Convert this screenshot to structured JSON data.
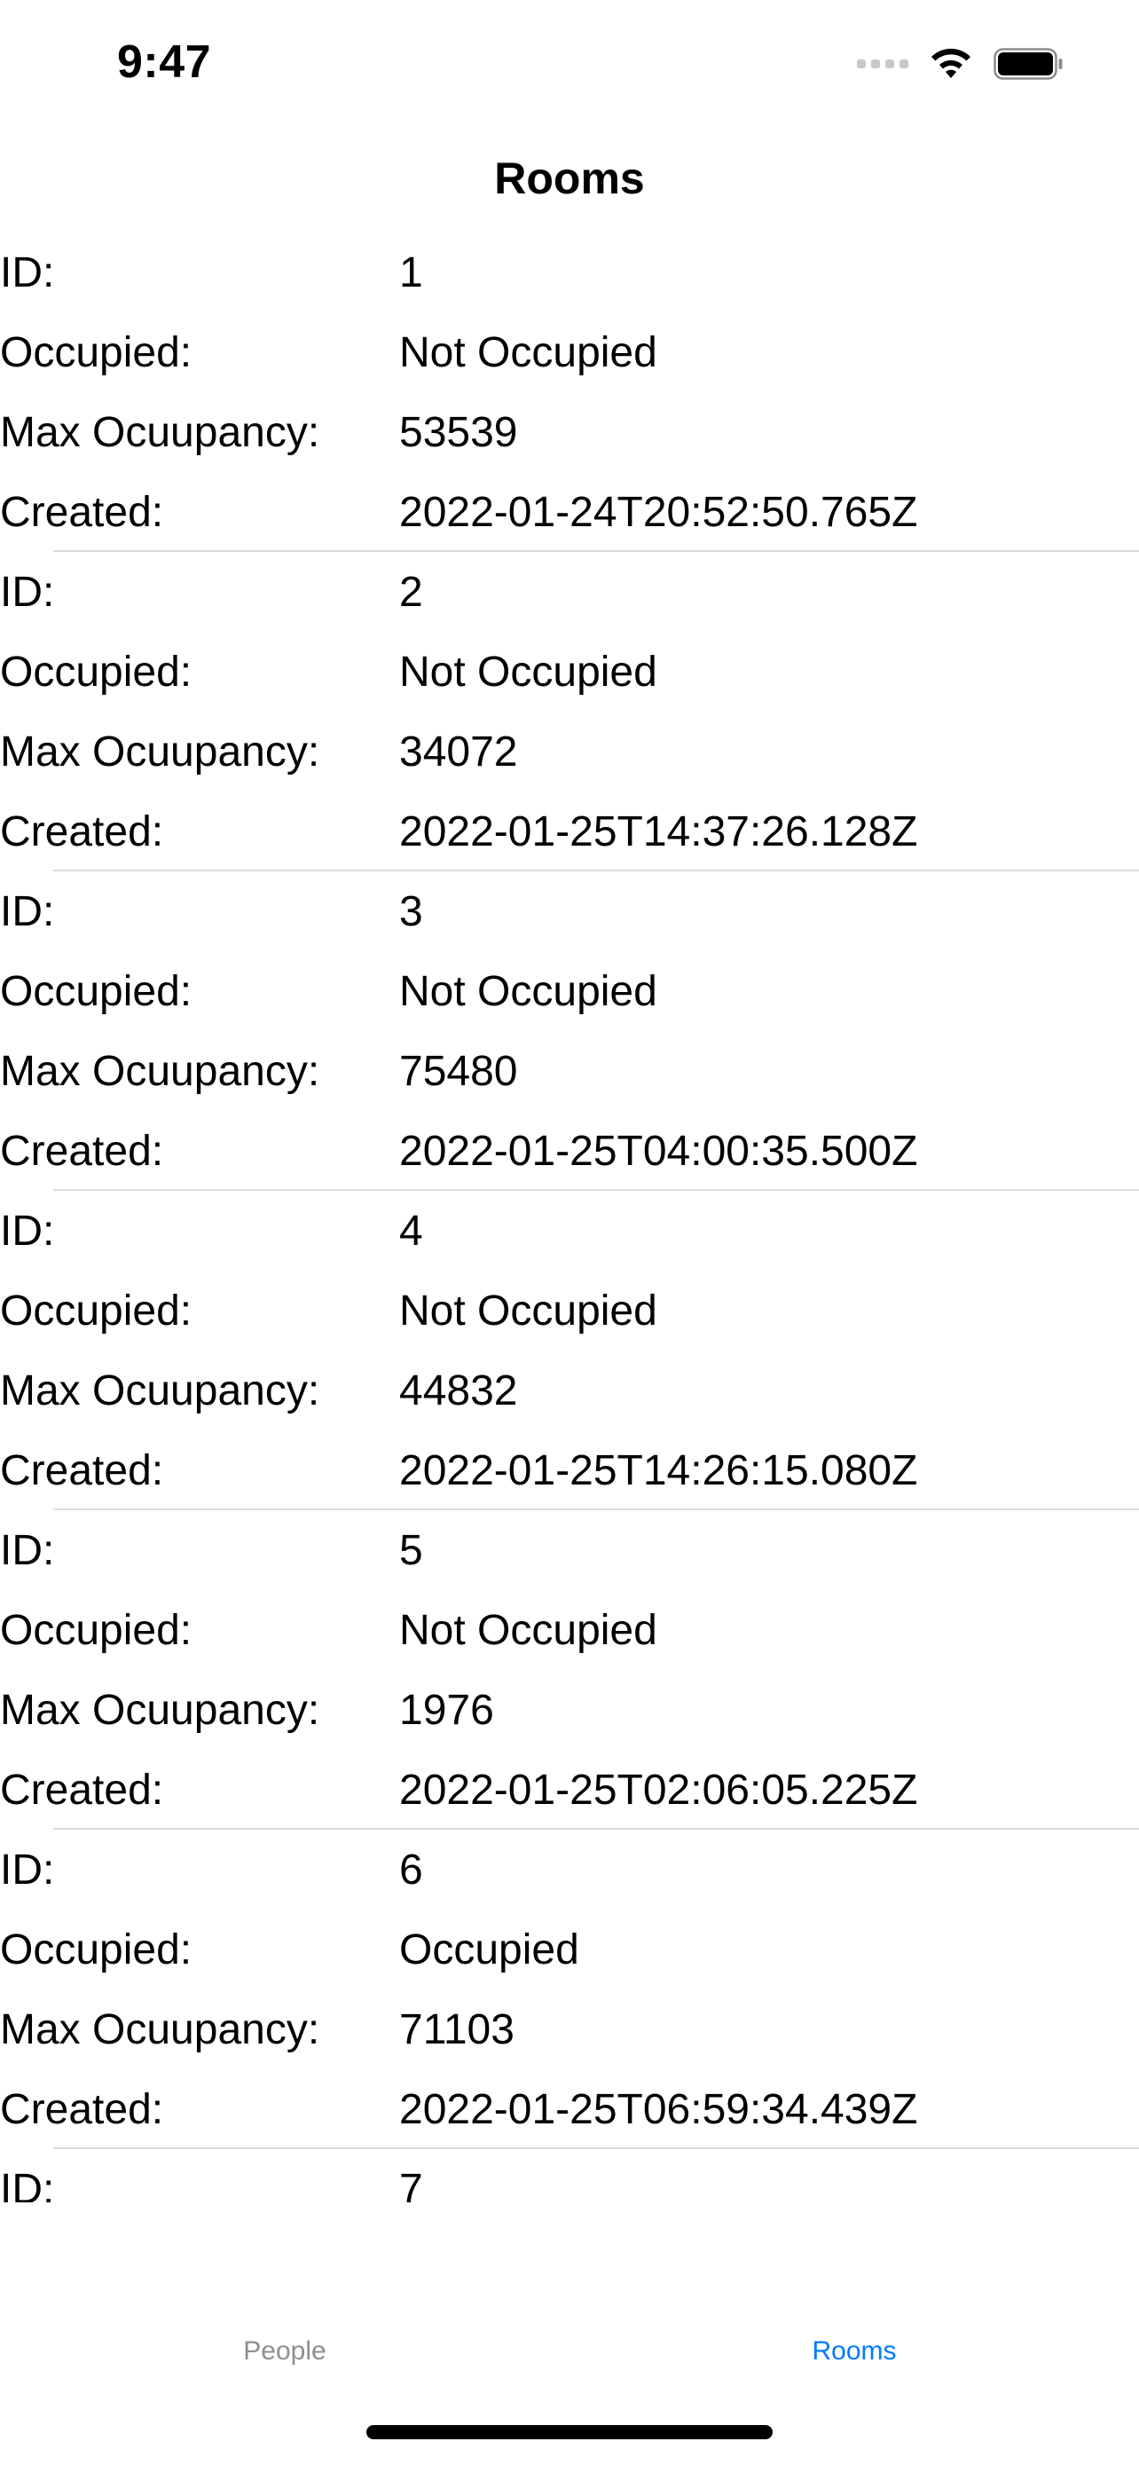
{
  "status_bar": {
    "time": "9:47",
    "icons": [
      "signal-icon",
      "wifi-icon",
      "battery-icon"
    ]
  },
  "nav": {
    "title": "Rooms"
  },
  "field_labels": {
    "id": "ID:",
    "occupied": "Occupied:",
    "max_occupancy": "Max Ocuupancy:",
    "created": "Created:"
  },
  "rooms": [
    {
      "id": "1",
      "occupied": "Not Occupied",
      "max_occupancy": "53539",
      "created": "2022-01-24T20:52:50.765Z"
    },
    {
      "id": "2",
      "occupied": "Not Occupied",
      "max_occupancy": "34072",
      "created": "2022-01-25T14:37:26.128Z"
    },
    {
      "id": "3",
      "occupied": "Not Occupied",
      "max_occupancy": "75480",
      "created": "2022-01-25T04:00:35.500Z"
    },
    {
      "id": "4",
      "occupied": "Not Occupied",
      "max_occupancy": "44832",
      "created": "2022-01-25T14:26:15.080Z"
    },
    {
      "id": "5",
      "occupied": "Not Occupied",
      "max_occupancy": "1976",
      "created": "2022-01-25T02:06:05.225Z"
    },
    {
      "id": "6",
      "occupied": "Occupied",
      "max_occupancy": "71103",
      "created": "2022-01-25T06:59:34.439Z"
    },
    {
      "id": "7"
    }
  ],
  "tab_bar": {
    "tabs": [
      {
        "label": "People",
        "selected": false
      },
      {
        "label": "Rooms",
        "selected": true
      }
    ],
    "selected_color": "#007aff",
    "unselected_color": "#8e8e93"
  }
}
